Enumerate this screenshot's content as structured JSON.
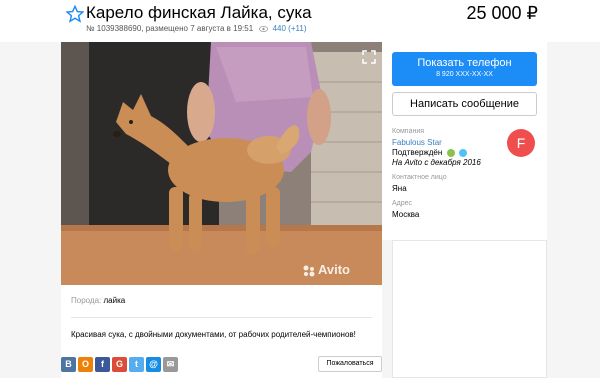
{
  "header": {
    "title": "Карело финская Лайка, сука",
    "price": "25 000 ₽",
    "meta": "№ 1039388690, размещено 7 августа в 19:51",
    "views": "440 (+11)"
  },
  "photo": {
    "watermark": "Avito"
  },
  "details": {
    "breed_label": "Порода:",
    "breed_value": "лайка",
    "description": "Красивая сука, с двойными документами, от рабочих родителей-чемпионов!"
  },
  "share": [
    {
      "label": "В",
      "color": "#4c75a3",
      "name": "vk"
    },
    {
      "label": "О",
      "color": "#ee8208",
      "name": "ok"
    },
    {
      "label": "f",
      "color": "#3b5998",
      "name": "facebook"
    },
    {
      "label": "G",
      "color": "#dd4b39",
      "name": "google"
    },
    {
      "label": "t",
      "color": "#55acee",
      "name": "twitter"
    },
    {
      "label": "@",
      "color": "#168de2",
      "name": "mailru"
    },
    {
      "label": "✉",
      "color": "#999999",
      "name": "email"
    }
  ],
  "complain_label": "Пожаловаться",
  "contact": {
    "phone_button": "Показать телефон",
    "phone_masked": "8 920 XXX-XX-XX",
    "message_button": "Написать сообщение",
    "company_label": "Компания",
    "company_name": "Fabulous Star",
    "verified": "Подтверждён",
    "since": "На Avito с декабря 2016",
    "person_label": "Контактное лицо",
    "person_name": "Яна",
    "address_label": "Адрес",
    "address_value": "Москва",
    "avatar_letter": "F"
  },
  "colors": {
    "accent": "#1c8cf6",
    "link": "#3a7fc1",
    "avatar": "#f04e4e"
  }
}
